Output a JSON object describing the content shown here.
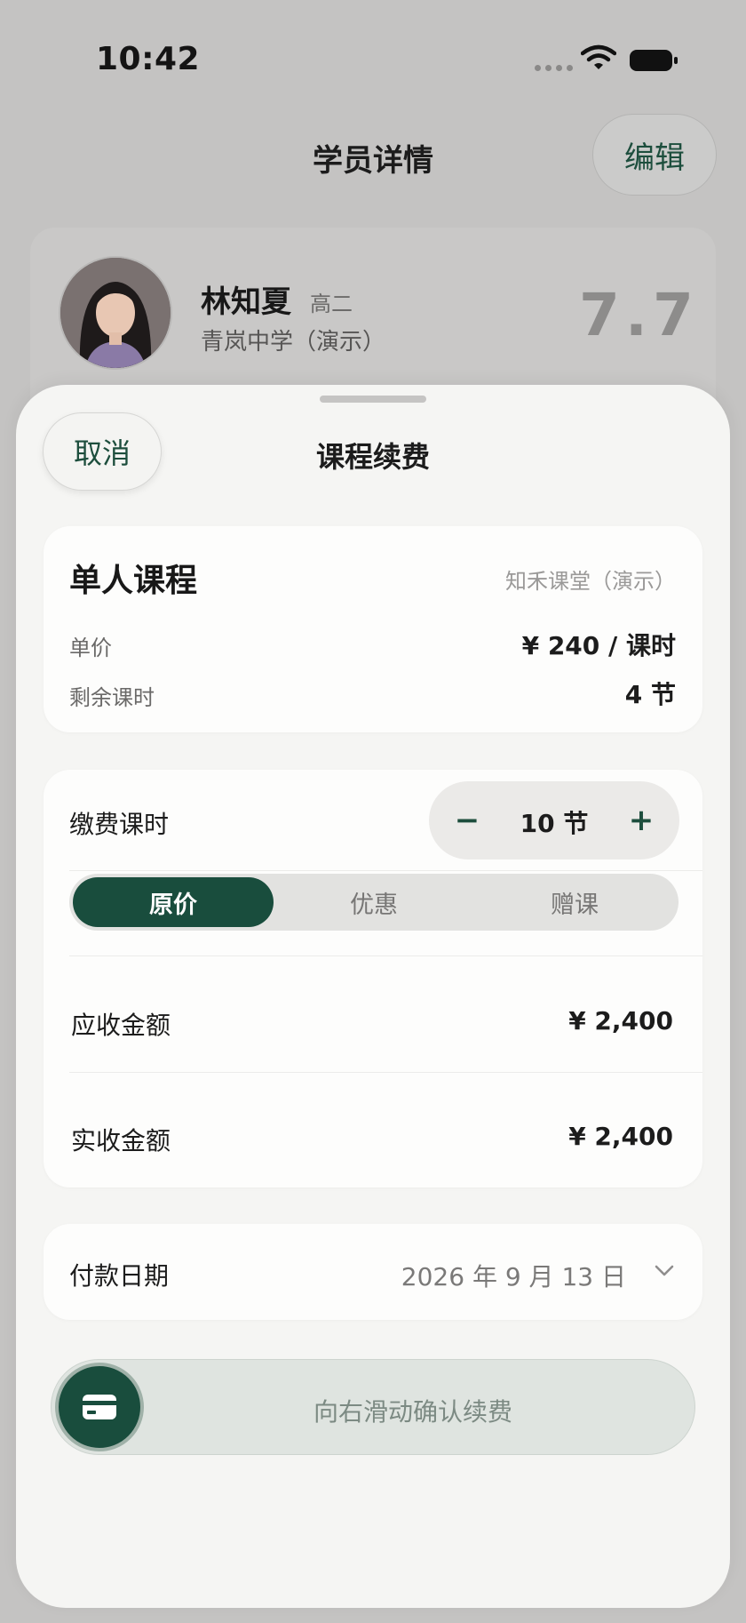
{
  "status_bar": {
    "time": "10:42"
  },
  "page": {
    "title": "学员详情",
    "edit_label": "编辑",
    "student": {
      "name": "林知夏",
      "grade": "高二",
      "school": "青岚中学（演示）",
      "score": "7.7"
    }
  },
  "sheet": {
    "cancel_label": "取消",
    "title": "课程续费",
    "course": {
      "name": "单人课程",
      "org": "知禾课堂（演示）",
      "price_label": "单价",
      "price_value": "¥ 240 / 课时",
      "remaining_label": "剩余课时",
      "remaining_value": "4 节"
    },
    "payment": {
      "hours_label": "缴费课时",
      "hours_value": "10 节",
      "minus": "−",
      "plus": "+",
      "options": [
        "原价",
        "优惠",
        "赠课"
      ],
      "selected_option": "原价",
      "receivable_label": "应收金额",
      "receivable_value": "¥ 2,400",
      "received_label": "实收金额",
      "received_value": "¥ 2,400"
    },
    "date": {
      "label": "付款日期",
      "value": "2026 年 9 月 13 日"
    },
    "slider_text": "向右滑动确认续费"
  },
  "colors": {
    "accent": "#194d3d",
    "background": "#c4c3c2",
    "sheet": "#f5f5f3"
  },
  "icons": [
    "wifi-icon",
    "battery-icon",
    "minus-icon",
    "plus-icon",
    "chevron-down-icon",
    "card-icon"
  ]
}
